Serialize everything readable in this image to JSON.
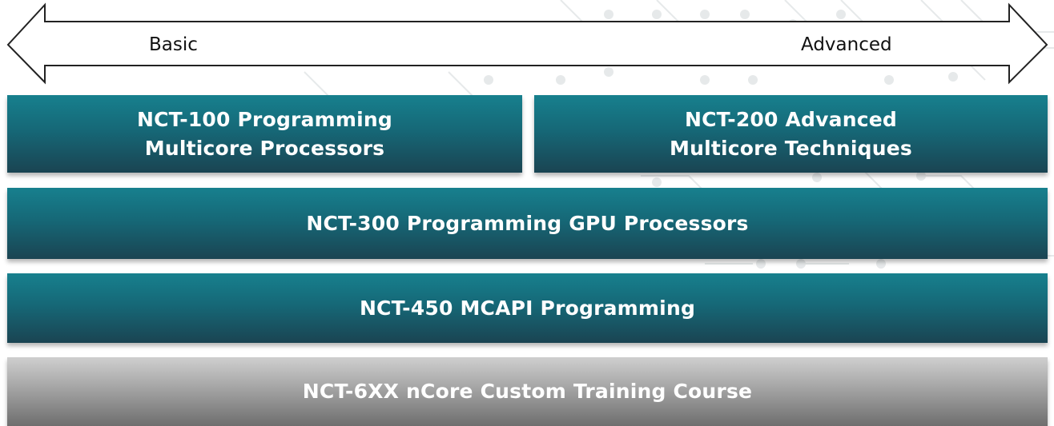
{
  "scale": {
    "left_label": "Basic",
    "right_label": "Advanced"
  },
  "courses": [
    {
      "id": "nct-100",
      "lines": [
        "NCT-100 Programming",
        "Multicore Processors"
      ],
      "style": "teal"
    },
    {
      "id": "nct-200",
      "lines": [
        "NCT-200 Advanced",
        "Multicore Techniques"
      ],
      "style": "teal"
    },
    {
      "id": "nct-300",
      "lines": [
        "NCT-300 Programming GPU Processors"
      ],
      "style": "teal"
    },
    {
      "id": "nct-450",
      "lines": [
        "NCT-450 MCAPI Programming"
      ],
      "style": "teal"
    },
    {
      "id": "nct-6xx",
      "lines": [
        "NCT-6XX nCore Custom Training Course"
      ],
      "style": "gray"
    }
  ],
  "colors": {
    "teal_top": "#17808e",
    "teal_bottom": "#1a4452",
    "gray_top": "#cfcfcf",
    "gray_bottom": "#6e6e6e"
  }
}
